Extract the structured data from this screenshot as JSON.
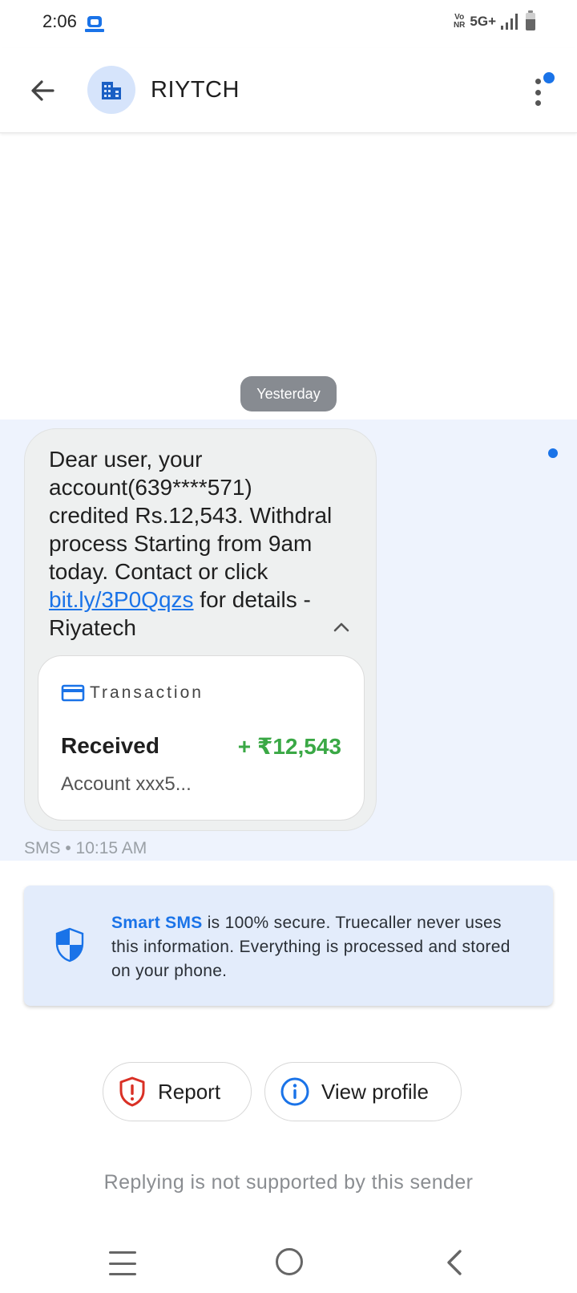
{
  "status_bar": {
    "time": "2:06",
    "volte_top": "Vo",
    "volte_bottom": "NR",
    "network": "5G+"
  },
  "header": {
    "sender_name": "RIYTCH",
    "avatar_icon": "building-icon",
    "menu_badge_color": "#1a73e8"
  },
  "conversation": {
    "date_chip": "Yesterday",
    "message": {
      "text_before_link": "Dear user, your account(639****571) credited Rs.12,543. Withdral process Starting from 9am today. Contact or click ",
      "link": "bit.ly/3P0Qqzs",
      "text_after_link": " for details -Riyatech",
      "meta": "SMS • 10:15 AM"
    },
    "transaction_card": {
      "title": "Transaction",
      "label": "Received",
      "amount": "+ ₹12,543",
      "account": "Account xxx5..."
    }
  },
  "notice": {
    "strong": "Smart SMS",
    "text": " is 100% secure. Truecaller never uses this information. Everything is processed and stored on your phone."
  },
  "actions": {
    "report_label": "Report",
    "view_profile_label": "View profile"
  },
  "footer_note": "Replying is not supported by this sender",
  "colors": {
    "accent": "#1a73e8",
    "amount_green": "#3aa845",
    "band": "#eef3fd"
  }
}
